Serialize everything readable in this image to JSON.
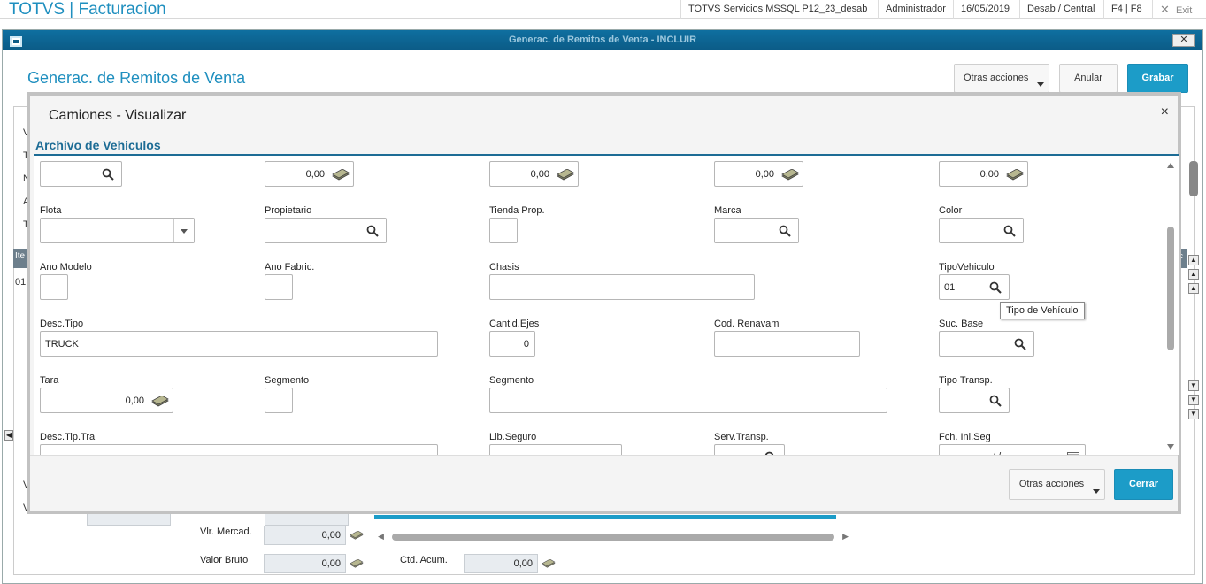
{
  "topbar": {
    "app_title": "TOTVS | Facturacion",
    "server": "TOTVS Servicios MSSQL P12_23_desab",
    "user": "Administrador",
    "date": "16/05/2019",
    "environment": "Desab / Central",
    "shortcuts": "F4 | F8",
    "exit_label": "Exit"
  },
  "window": {
    "title": "Generac. de Remitos de Venta - INCLUIR",
    "close_label": "✕",
    "page_title": "Generac. de Remitos de Venta",
    "other_actions": "Otras acciones",
    "cancel": "Anular",
    "save": "Grabar",
    "bg_letters": [
      "V",
      "T",
      "N",
      "A",
      "T"
    ],
    "bg_tab": "Ite",
    "bg_row": "01",
    "bg_right_tab": "Ic",
    "bg_bottom_letters": [
      "V",
      "V"
    ],
    "bottom": {
      "vlr_mercad_label": "Vlr. Mercad.",
      "vlr_mercad_value": "0,00",
      "valor_bruto_label": "Valor Bruto",
      "valor_bruto_value": "0,00",
      "ctd_acum_label": "Ctd. Acum.",
      "ctd_acum_value": "0,00"
    }
  },
  "modal": {
    "title": "Camiones - Visualizar",
    "close": "×",
    "section": "Archivo de Vehiculos",
    "row0": {
      "v1": "0,00",
      "v2": "0,00",
      "v3": "0,00",
      "v4": "0,00"
    },
    "fields": {
      "flota": "Flota",
      "propietario": "Propietario",
      "tienda_prop": "Tienda Prop.",
      "marca": "Marca",
      "color": "Color",
      "ano_modelo": "Ano Modelo",
      "ano_fabric": "Ano Fabric.",
      "chasis": "Chasis",
      "tipo_vehiculo": "TipoVehiculo",
      "tipo_vehiculo_value": "01",
      "desc_tipo": "Desc.Tipo",
      "desc_tipo_value": "TRUCK",
      "cantid_ejes": "Cantid.Ejes",
      "cantid_ejes_value": "0",
      "cod_renavam": "Cod. Renavam",
      "suc_base": "Suc. Base",
      "tara": "Tara",
      "tara_value": "0,00",
      "segmento1": "Segmento",
      "segmento2": "Segmento",
      "tipo_transp": "Tipo Transp.",
      "desc_tip_tra": "Desc.Tip.Tra",
      "lib_seguro": "Lib.Seguro",
      "serv_transp": "Serv.Transp.",
      "fch_ini_seg": "Fch. Ini.Seg",
      "fch_ini_seg_value": "/ /"
    },
    "tooltip": "Tipo de Vehículo",
    "other_actions": "Otras acciones",
    "close_button": "Cerrar"
  },
  "colors": {
    "accent": "#1c9cc8",
    "title_blue": "#1f8fbf",
    "section_blue": "#1d6c95"
  }
}
